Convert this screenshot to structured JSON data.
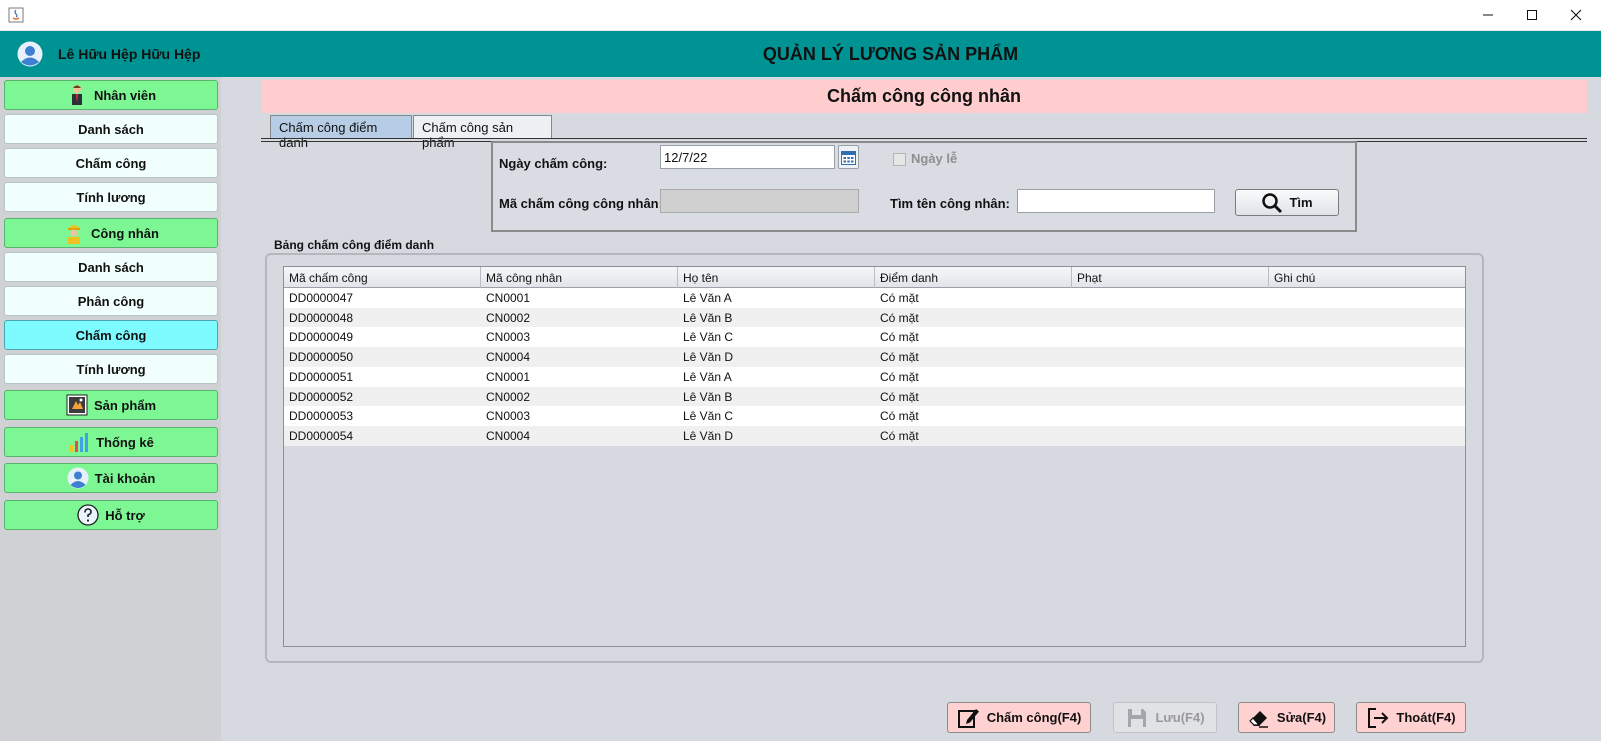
{
  "window": {
    "controls": {
      "minimize": "—",
      "maximize": "☐",
      "close": "✕"
    }
  },
  "header": {
    "user_name": "Lê Hữu Hệp Hữu Hệp",
    "app_title": "QUẢN LÝ LƯƠNG SẢN PHẨM"
  },
  "sidebar": {
    "employees": "Nhân viên",
    "employees_list": "Danh sách",
    "employees_attendance": "Chấm công",
    "employees_salary": "Tính lương",
    "workers": "Công nhân",
    "workers_list": "Danh sách",
    "workers_assign": "Phân công",
    "workers_attendance": "Chấm công",
    "workers_salary": "Tính lương",
    "products": "Sản phẩm",
    "statistics": "Thống kê",
    "account": "Tài khoản",
    "support": "Hỗ trợ"
  },
  "page": {
    "banner": "Chấm công công nhân",
    "tabs": [
      "Chấm công điểm danh",
      "Chấm công sản phẩm"
    ],
    "active_tab": "Chấm công điểm danh"
  },
  "filter": {
    "date_label": "Ngày chấm công:",
    "date_value": "12/7/22",
    "holiday_label": "Ngày lễ",
    "holiday_checked": false,
    "code_label": "Mã chấm công công nhân:",
    "code_value": "",
    "name_label": "Tìm tên công nhân:",
    "name_value": "",
    "search_label": "Tìm"
  },
  "table": {
    "caption": "Bảng chấm công điểm danh",
    "columns": [
      "Mã chấm công",
      "Mã công nhân",
      "Họ tên",
      "Điểm danh",
      "Phạt",
      "Ghi chú"
    ],
    "rows": [
      [
        "DD0000047",
        "CN0001",
        "Lê Văn A",
        "Có mặt",
        "",
        ""
      ],
      [
        "DD0000048",
        "CN0002",
        "Lê Văn B",
        "Có mặt",
        "",
        ""
      ],
      [
        "DD0000049",
        "CN0003",
        "Lê Văn C",
        "Có mặt",
        "",
        ""
      ],
      [
        "DD0000050",
        "CN0004",
        "Lê Văn D",
        "Có mặt",
        "",
        ""
      ],
      [
        "DD0000051",
        "CN0001",
        "Lê Văn A",
        "Có mặt",
        "",
        ""
      ],
      [
        "DD0000052",
        "CN0002",
        "Lê Văn B",
        "Có mặt",
        "",
        ""
      ],
      [
        "DD0000053",
        "CN0003",
        "Lê Văn C",
        "Có mặt",
        "",
        ""
      ],
      [
        "DD0000054",
        "CN0004",
        "Lê Văn D",
        "Có mặt",
        "",
        ""
      ]
    ]
  },
  "actions": {
    "attend": "Chấm công(F4)",
    "save": "Lưu(F4)",
    "edit": "Sửa(F4)",
    "exit": "Thoát(F4)"
  },
  "colors": {
    "header_bg": "#009393",
    "sidebar_main_bg": "#7df794",
    "sidebar_active_bg": "#7dfbff",
    "banner_bg": "#ffcdcd",
    "action_btn_bg": "#ffd1d1"
  }
}
